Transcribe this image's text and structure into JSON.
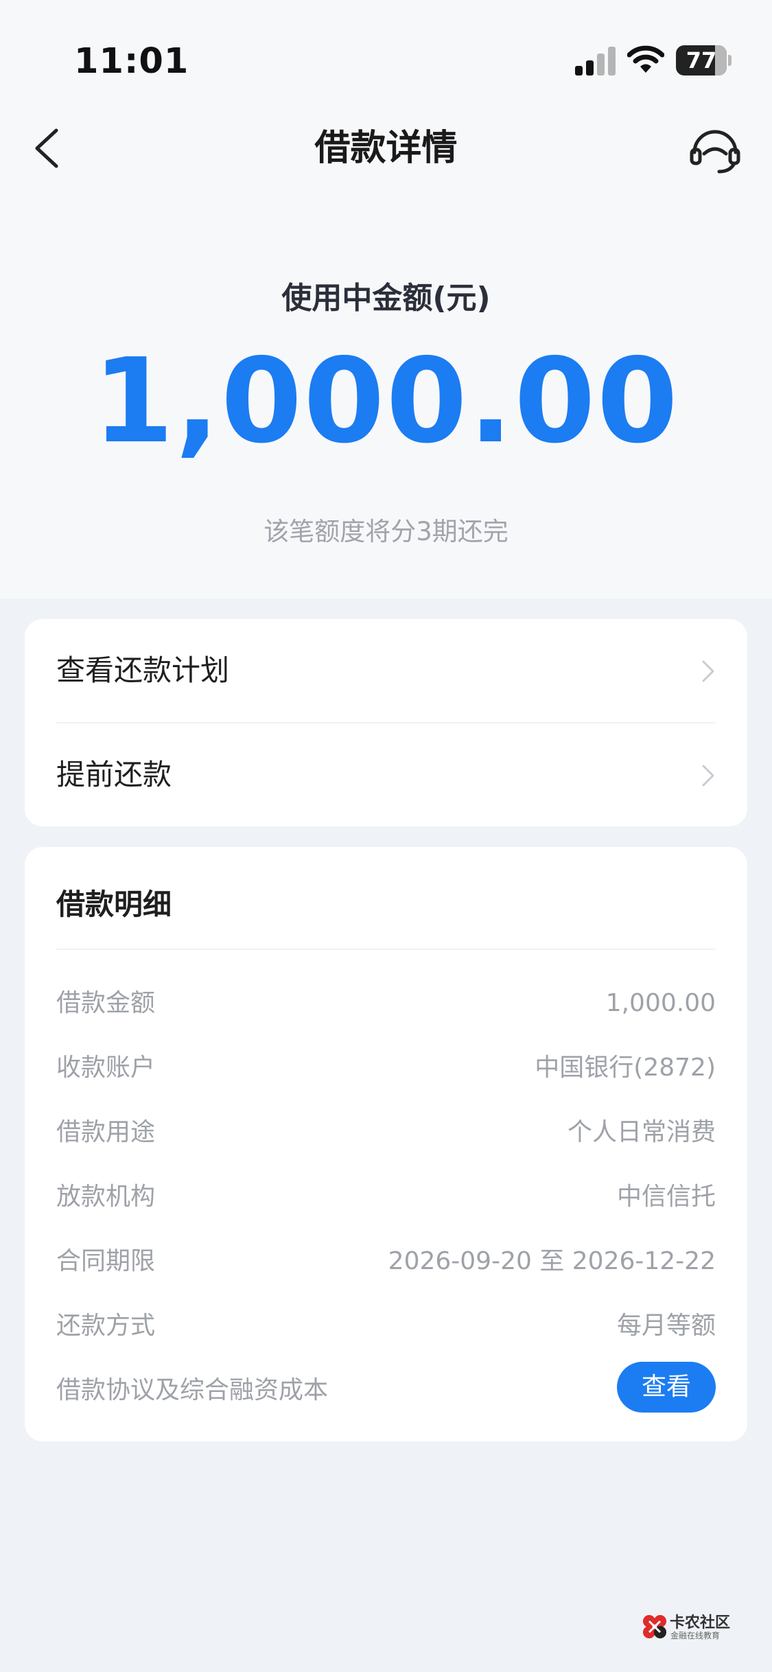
{
  "status_bar": {
    "time": "11:01",
    "battery": "77",
    "battery_level": 0.77
  },
  "nav": {
    "title": "借款详情",
    "back_icon": "chevron-left-icon",
    "service_icon": "customer-service-headset-icon"
  },
  "hero": {
    "label": "使用中金额(元)",
    "amount": "1,000.00",
    "subtitle": "该笔额度将分3期还完"
  },
  "actions": [
    {
      "label": "查看还款计划"
    },
    {
      "label": "提前还款"
    }
  ],
  "details": {
    "title": "借款明细",
    "rows": [
      {
        "key": "借款金额",
        "value": "1,000.00"
      },
      {
        "key": "收款账户",
        "value": "中国银行(2872)"
      },
      {
        "key": "借款用途",
        "value": "个人日常消费"
      },
      {
        "key": "放款机构",
        "value": "中信信托"
      },
      {
        "key": "合同期限",
        "value": "2026-09-20 至 2026-12-22"
      },
      {
        "key": "还款方式",
        "value": "每月等额"
      }
    ],
    "agreement": {
      "key": "借款协议及综合融资成本",
      "button": "查看"
    }
  },
  "watermark": {
    "name": "卡农社区",
    "sub": "金融在线教育"
  },
  "colors": {
    "accent": "#1c7cf2",
    "page_bg": "#eff2f7",
    "muted": "#9ea2a8"
  }
}
